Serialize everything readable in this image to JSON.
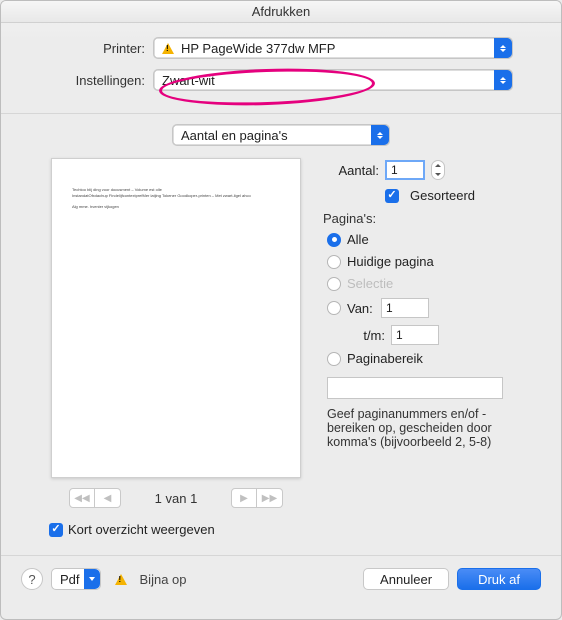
{
  "title": "Afdrukken",
  "printer": {
    "label": "Printer:",
    "value": "HP PageWide 377dw MFP"
  },
  "settings": {
    "label": "Instellingen:",
    "value": "Zwart-wit"
  },
  "section_select": "Aantal en pagina's",
  "preview": {
    "text_line1": "Techtoo blij ding voor docusment – Volume est olle",
    "text_line2": "InstandatOfxdachup FindelijfcontextprefMer latjing Tokener Goodkoper-printen – Met zwart-ligel ahco",
    "text_line3": "Alg mme. hvenier vijkogen",
    "pager": "1 van 1"
  },
  "copies": {
    "label": "Aantal:",
    "value": "1",
    "sorted_label": "Gesorteerd"
  },
  "pages": {
    "heading": "Pagina's:",
    "all": "Alle",
    "current": "Huidige pagina",
    "selection": "Selectie",
    "from_label": "Van:",
    "from_value": "1",
    "to_label": "t/m:",
    "to_value": "1",
    "range_label": "Paginabereik",
    "hint": "Geef paginanummers en/of -bereiken op, gescheiden door komma's (bijvoorbeeld 2, 5-8)"
  },
  "short_overview": "Kort overzicht weergeven",
  "footer": {
    "pdf_label": "Pdf",
    "status": "Bijna op",
    "cancel": "Annuleer",
    "print": "Druk af"
  }
}
